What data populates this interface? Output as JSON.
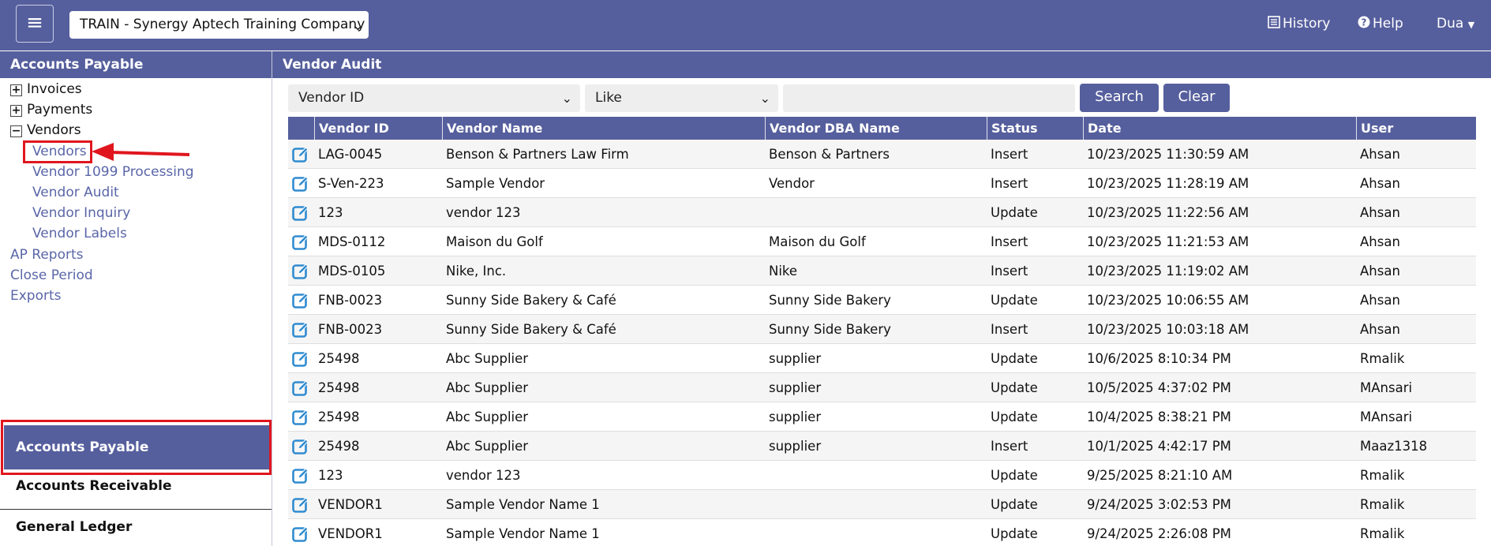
{
  "topbar": {
    "menu_icon": "hamburger-icon",
    "company": "TRAIN - Synergy Aptech Training Company",
    "history": "History",
    "help": "Help",
    "user": "Dua"
  },
  "sidebar": {
    "title": "Accounts Payable",
    "tree": [
      {
        "label": "Invoices",
        "toggle": "+"
      },
      {
        "label": "Payments",
        "toggle": "+"
      },
      {
        "label": "Vendors",
        "toggle": "−"
      }
    ],
    "vendor_children": [
      "Vendors",
      "Vendor 1099 Processing",
      "Vendor Audit",
      "Vendor Inquiry",
      "Vendor Labels"
    ],
    "links": [
      "AP Reports",
      "Close Period",
      "Exports"
    ],
    "modules": {
      "active": "Accounts Payable",
      "others": [
        "Accounts Receivable",
        "General Ledger"
      ]
    }
  },
  "main": {
    "title": "Vendor Audit",
    "filter": {
      "field": "Vendor ID",
      "operator": "Like",
      "value": "",
      "search": "Search",
      "clear": "Clear"
    },
    "columns": [
      "Vendor ID",
      "Vendor Name",
      "Vendor DBA Name",
      "Status",
      "Date",
      "User"
    ],
    "rows": [
      [
        "LAG-0045",
        "Benson & Partners Law Firm",
        "Benson & Partners",
        "Insert",
        "10/23/2025 11:30:59 AM",
        "Ahsan"
      ],
      [
        "S-Ven-223",
        "Sample Vendor",
        "Vendor",
        "Insert",
        "10/23/2025 11:28:19 AM",
        "Ahsan"
      ],
      [
        "123",
        "vendor 123",
        "",
        "Update",
        "10/23/2025 11:22:56 AM",
        "Ahsan"
      ],
      [
        "MDS-0112",
        "Maison du Golf",
        "Maison du Golf",
        "Insert",
        "10/23/2025 11:21:53 AM",
        "Ahsan"
      ],
      [
        "MDS-0105",
        "Nike, Inc.",
        "Nike",
        "Insert",
        "10/23/2025 11:19:02 AM",
        "Ahsan"
      ],
      [
        "FNB-0023",
        "Sunny Side Bakery & Café",
        "Sunny Side Bakery",
        "Update",
        "10/23/2025 10:06:55 AM",
        "Ahsan"
      ],
      [
        "FNB-0023",
        "Sunny Side Bakery & Café",
        "Sunny Side Bakery",
        "Insert",
        "10/23/2025 10:03:18 AM",
        "Ahsan"
      ],
      [
        "25498",
        "Abc Supplier",
        "supplier",
        "Update",
        "10/6/2025 8:10:34 PM",
        "Rmalik"
      ],
      [
        "25498",
        "Abc Supplier",
        "supplier",
        "Update",
        "10/5/2025 4:37:02 PM",
        "MAnsari"
      ],
      [
        "25498",
        "Abc Supplier",
        "supplier",
        "Update",
        "10/4/2025 8:38:21 PM",
        "MAnsari"
      ],
      [
        "25498",
        "Abc Supplier",
        "supplier",
        "Insert",
        "10/1/2025 4:42:17 PM",
        "Maaz1318"
      ],
      [
        "123",
        "vendor 123",
        "",
        "Update",
        "9/25/2025 8:21:10 AM",
        "Rmalik"
      ],
      [
        "VENDOR1",
        "Sample Vendor Name 1",
        "",
        "Update",
        "9/24/2025 3:02:53 PM",
        "Rmalik"
      ],
      [
        "VENDOR1",
        "Sample Vendor Name 1",
        "",
        "Update",
        "9/24/2025 2:26:08 PM",
        "Rmalik"
      ]
    ]
  },
  "colors": {
    "primary": "#565f9d",
    "link": "#5a66a8",
    "highlight": "#e0161e"
  }
}
